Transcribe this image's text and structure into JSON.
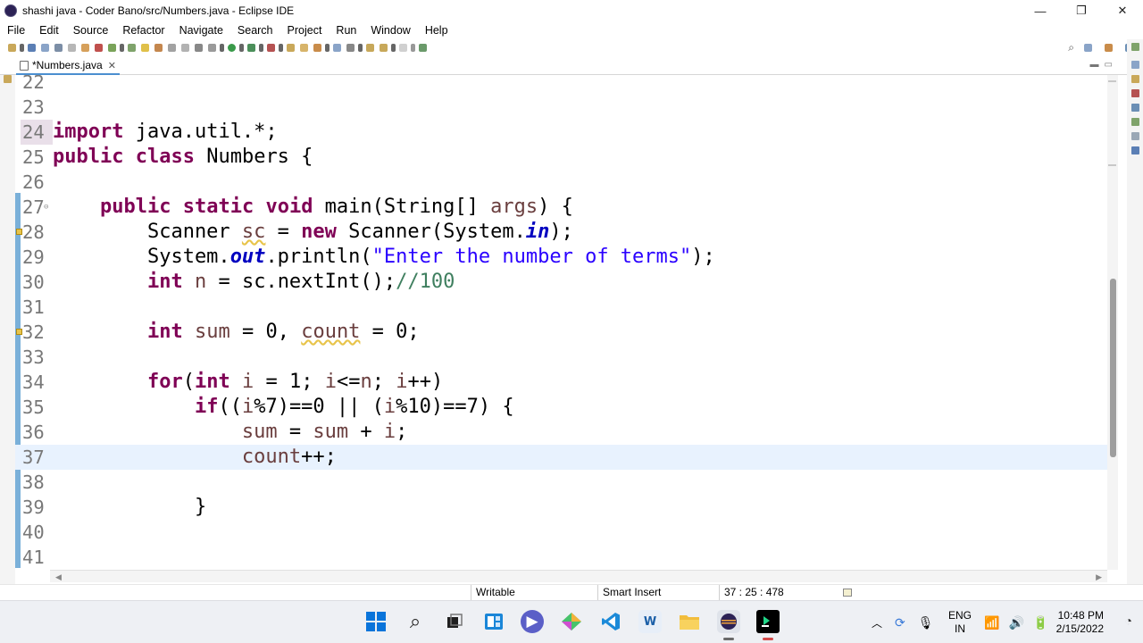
{
  "window": {
    "title": "shashi java - Coder Bano/src/Numbers.java - Eclipse IDE",
    "minimize": "—",
    "maximize": "❐",
    "close": "✕"
  },
  "menu": [
    "File",
    "Edit",
    "Source",
    "Refactor",
    "Navigate",
    "Search",
    "Project",
    "Run",
    "Window",
    "Help"
  ],
  "editor_tab": {
    "label": "*Numbers.java",
    "close": "✕"
  },
  "code_lines": [
    {
      "num": "22",
      "code": ""
    },
    {
      "num": "23",
      "code": ""
    },
    {
      "num": "24",
      "code": "import java.util.*;"
    },
    {
      "num": "25",
      "code": "public class Numbers {"
    },
    {
      "num": "26",
      "code": ""
    },
    {
      "num": "27",
      "code": "    public static void main(String[] args) {"
    },
    {
      "num": "28",
      "code": "        Scanner sc = new Scanner(System.in);"
    },
    {
      "num": "29",
      "code": "        System.out.println(\"Enter the number of terms\");"
    },
    {
      "num": "30",
      "code": "        int n = sc.nextInt();//100"
    },
    {
      "num": "31",
      "code": ""
    },
    {
      "num": "32",
      "code": "        int sum = 0, count = 0;"
    },
    {
      "num": "33",
      "code": ""
    },
    {
      "num": "34",
      "code": "        for(int i = 1; i<=n; i++)"
    },
    {
      "num": "35",
      "code": "            if((i%7)==0 || (i%10)==7) {"
    },
    {
      "num": "36",
      "code": "                sum = sum + i;"
    },
    {
      "num": "37",
      "code": "                count++;"
    },
    {
      "num": "38",
      "code": ""
    },
    {
      "num": "39",
      "code": "            }"
    },
    {
      "num": "40",
      "code": ""
    },
    {
      "num": "41",
      "code": ""
    }
  ],
  "status": {
    "writable": "Writable",
    "insert_mode": "Smart Insert",
    "position": "37 : 25 : 478"
  },
  "taskbar": {
    "apps": [
      "start-icon",
      "search-icon",
      "file-explorer-icon",
      "snap-layout-icon",
      "teams-icon",
      "photos-icon",
      "vscode-icon",
      "word-icon",
      "folder-icon",
      "eclipse-icon",
      "pycharm-icon"
    ],
    "lang_line1": "ENG",
    "lang_line2": "IN",
    "time": "10:48 PM",
    "date": "2/15/2022"
  },
  "colors": {
    "keyword": "#7f0055",
    "string": "#2a00ff",
    "comment": "#3f7f5f",
    "static_field": "#0000c0",
    "current_line": "#e8f2fe"
  }
}
